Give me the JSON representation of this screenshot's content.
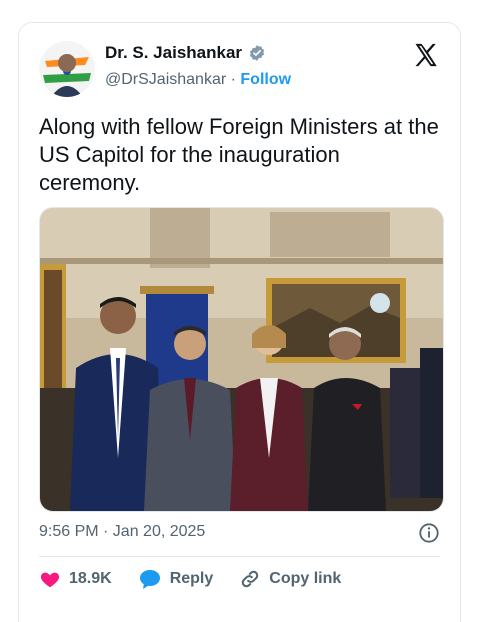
{
  "tweet": {
    "author": {
      "display_name": "Dr. S. Jaishankar",
      "handle": "@DrSJaishankar",
      "separator": "·",
      "follow_label": "Follow",
      "verified": true
    },
    "text": "Along with fellow Foreign Ministers at the US Capitol for the inauguration ceremony.",
    "timestamp": "9:56 PM · Jan 20, 2025",
    "actions": {
      "likes": "18.9K",
      "reply_label": "Reply",
      "copy_label": "Copy link"
    },
    "icons": [
      "verified-badge-icon",
      "x-logo-icon",
      "info-icon",
      "heart-icon",
      "reply-bubble-icon",
      "link-icon"
    ]
  },
  "colors": {
    "accent": "#1d9bf0",
    "text": "#0f1419",
    "muted": "#536471",
    "heart": "#f91880",
    "border": "#e1e8ed"
  }
}
